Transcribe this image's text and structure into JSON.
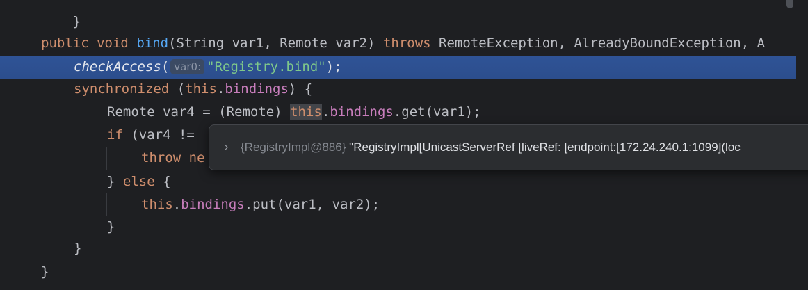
{
  "editor": {
    "lines": {
      "prev_brace": "}",
      "signature": {
        "public": "public",
        "void": "void",
        "name": "bind",
        "params": "(String var1, Remote var2) ",
        "throws": "throws",
        "exceptions": " RemoteException, AlreadyBoundException, A"
      },
      "check_access": {
        "name": "checkAccess",
        "open": "(",
        "hint": "var0:",
        "arg": "\"Registry.bind\"",
        "close": ");"
      },
      "synchronized": {
        "kw": "synchronized",
        "open": " (",
        "this": "this",
        "dot": ".",
        "field": "bindings",
        "close": ") {"
      },
      "remote_line": {
        "pre": "Remote var4 = (Remote) ",
        "this": "this",
        "dot": ".",
        "field": "bindings",
        "post": ".get(var1);"
      },
      "if_line": {
        "kw": "if",
        "post": " (var4 !="
      },
      "throw_line": {
        "kw": "throw",
        "post": " ne"
      },
      "else_line": {
        "pre": "} ",
        "kw": "else",
        "post": " {"
      },
      "put_line": {
        "this": "this",
        "dot": ".",
        "field": "bindings",
        "post": ".put(var1, var2);"
      },
      "close_inner": "}",
      "close_sync": "}",
      "close_method": "}"
    },
    "tooltip": {
      "chevron": "›",
      "type": "{RegistryImpl@886}",
      "value": " \"RegistryImpl[UnicastServerRef [liveRef: [endpoint:[172.24.240.1:1099](loc"
    }
  }
}
